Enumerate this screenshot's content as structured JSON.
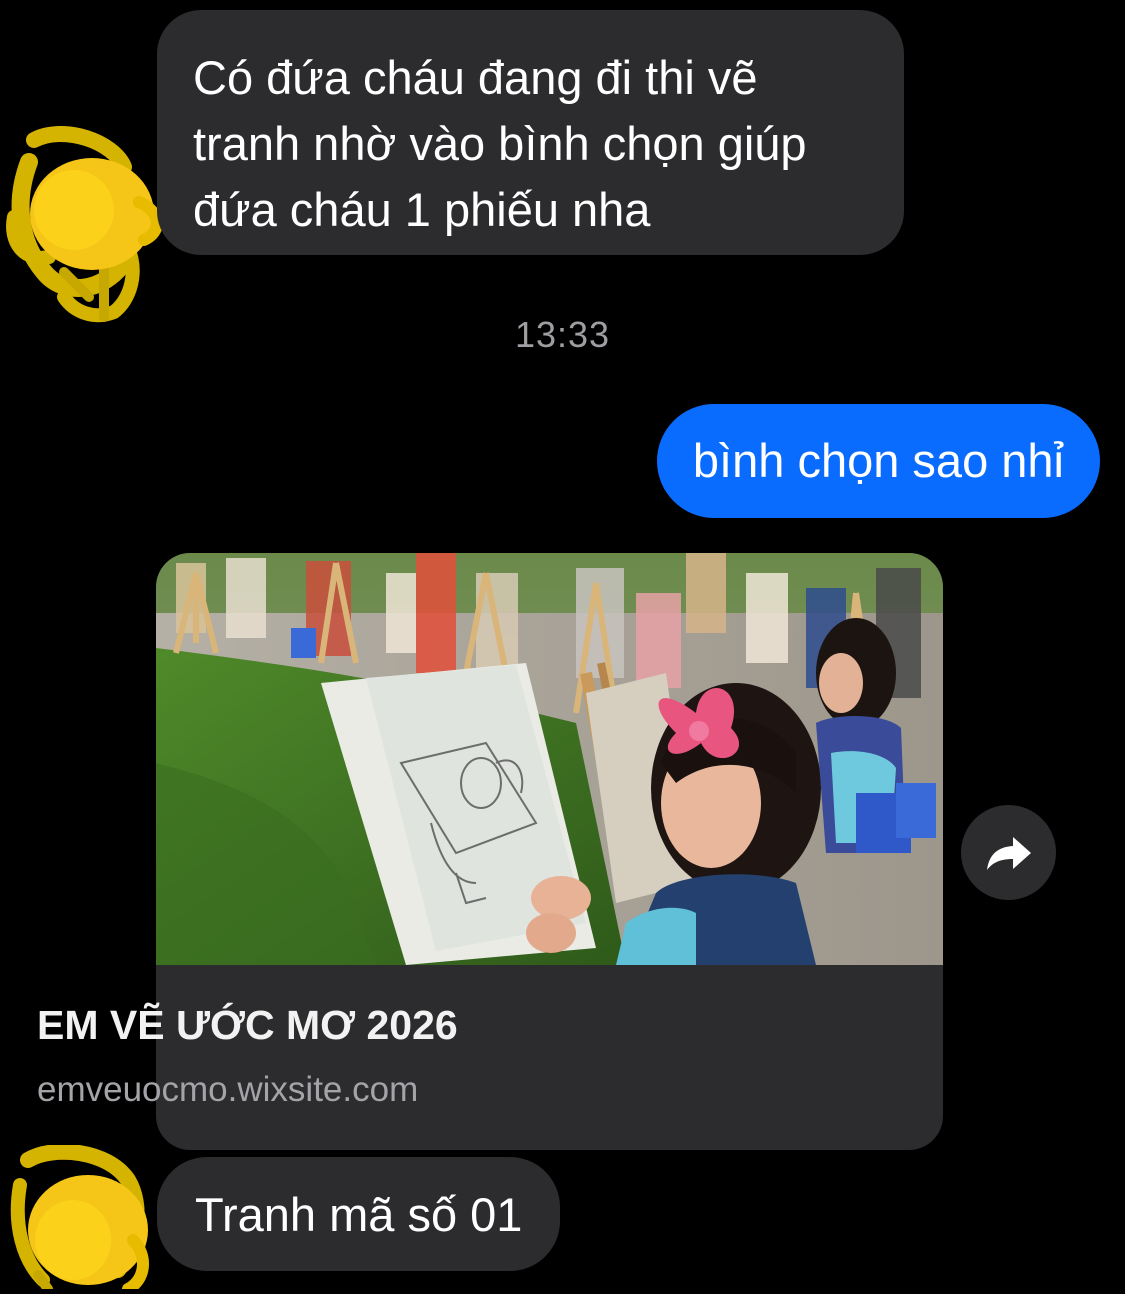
{
  "conversation": {
    "messages": [
      {
        "sender": "contact",
        "lines": [
          "Có đứa cháu đang đi thi vẽ",
          "tranh nhờ vào bình chọn giúp",
          "đứa cháu 1 phiếu nha"
        ]
      },
      {
        "sender": "me",
        "text": "bình chọn sao nhỉ"
      },
      {
        "sender": "contact",
        "text": "Tranh mã số 01"
      }
    ],
    "timestamp": "13:33",
    "link_preview": {
      "title": "EM VẼ ƯỚC MƠ 2026",
      "url": "emveuocmo.wixsite.com",
      "image_icon": "photo-of-children-drawing-at-easels"
    },
    "share_icon": "share-arrow-icon",
    "avatar_icon": "contact-avatar-scribbled-out"
  },
  "colors": {
    "background": "#000000",
    "incoming_bubble": "#2c2c2e",
    "outgoing_bubble": "#0a6cff",
    "timestamp_text": "#9e9ea3",
    "url_text": "#a4a4a8",
    "avatar_scribble": "#f5c518"
  }
}
